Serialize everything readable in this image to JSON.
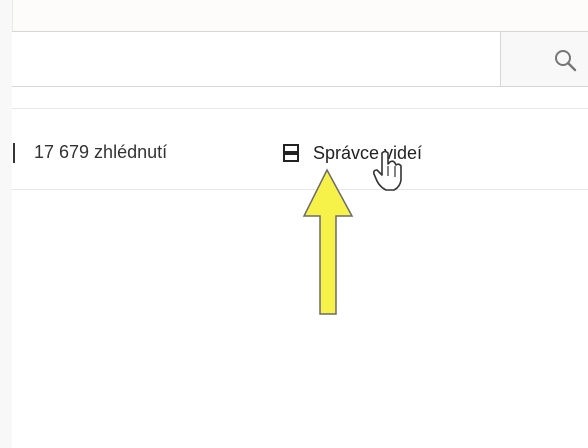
{
  "search": {
    "icon": "search-icon"
  },
  "info_bar": {
    "views": "17 679 zhlédnutí",
    "video_manager_label": "Správce videí",
    "video_manager_icon": "video-manager-icon"
  },
  "overlay": {
    "arrow_icon": "arrow-up-icon",
    "arrow_color": "#f7f24a",
    "cursor_icon": "hand-pointer-icon"
  },
  "colors": {
    "text": "#333333",
    "border": "#d6d6d6",
    "search_button_bg": "#f8f8f8"
  }
}
